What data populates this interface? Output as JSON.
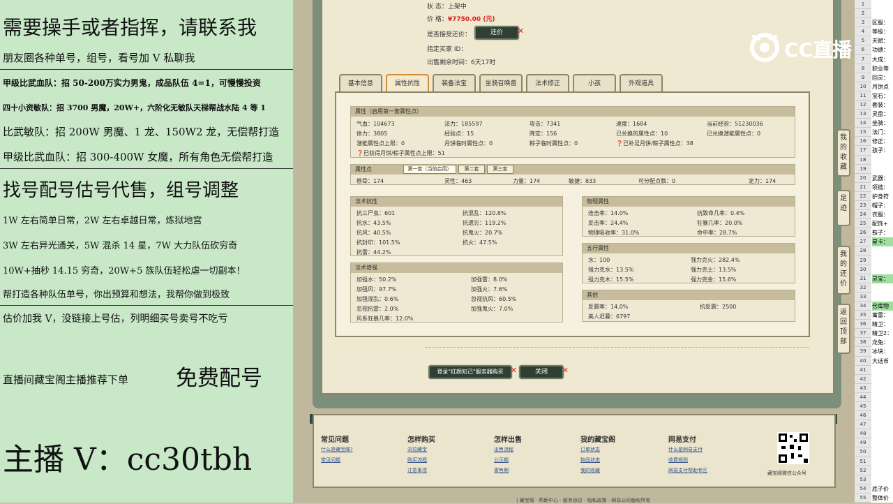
{
  "left": {
    "lines": [
      "需要操手或者指挥，请联系我",
      "朋友圈各种单号，组号，看号加 V 私聊我",
      "甲级比武血队：招 50-200万实力男鬼，成品队伍 4=1，可慢慢投资",
      "四十小资敏队：招 3700 男魔，20W+，六阶化无敏队天梯帮战水陆 4 等 1",
      "比武敏队：招 200W 男魔、1 龙、150W2 龙，无偿帮打造",
      "甲级比武血队：招 300-400W 女魔，所有角色无偿帮打造",
      "找号配号估号代售，组号调整",
      "1W 左右简单日常，2W 左右卓越日常，炼狱地宫",
      "3W 左右异光通关，5W 混杀 14 星，7W 大力队伍砍穷奇",
      "10W+抽秒 14.15 穷奇，20W+5 族队伍轻松虐一切副本！",
      "帮打造各种队伍单号，你出预算和想法，我帮你做到极致",
      "估价加我 V，没链接上号估，列明细买号卖号不吃亏",
      "直播间藏宝阁主播推荐下单",
      "免费配号",
      "主播 V：cc30tbh"
    ]
  },
  "game": {
    "info": {
      "status_label": "状        态：",
      "status_value": "上架中",
      "price_label": "价        格：",
      "price_value": "¥7750.00 (元)",
      "bargain_label": "是否接受还价：",
      "buyer_label": "指定买家 ID：",
      "time_label": "出售剩余时间：",
      "time_value": "6天17时"
    },
    "counter_offer_button": "还价",
    "tabs": [
      "基本信息",
      "属性抗性",
      "装备法宝",
      "坐骑召唤兽",
      "法术修正",
      "小孩",
      "外观道具"
    ],
    "attr_panel": {
      "title": "属性（启用第一套属性点）",
      "row1": [
        "气血：104673",
        "法力：185597",
        "攻击：7341",
        "速度：1684",
        "当前经验：51230036"
      ],
      "row2": [
        "体力：3805",
        "经验点：15",
        "降定：156",
        "已兑换的属性点：10",
        "已兑换潜能属性点：0"
      ],
      "row3": [
        "潜能属性点上限：0",
        "月饼临时属性点：0",
        "粽子临时属性点：0",
        "已补足月饼/粽子属性点：38"
      ],
      "row4": "已获得月饼/粽子属性点上限：51"
    },
    "points_panel": {
      "title": "属性点",
      "subtabs": [
        "第一套（当前启用）",
        "第二套",
        "第三套"
      ],
      "values": [
        "根骨：174",
        "灵性：463",
        "力量：174",
        "敏捷：833",
        "可分配点数：0",
        "定力：174"
      ]
    },
    "resist_panel": {
      "title": "法术抗性",
      "left": [
        "抗三尸虫：601",
        "抗水：43.5%",
        "抗风：40.5%",
        "抗封印：101.5%",
        "抗雷：44.2%"
      ],
      "right": [
        "抗混乱：120.8%",
        "抗遗忘：119.2%",
        "抗鬼火：20.7%",
        "抗火：47.5%"
      ]
    },
    "boost_panel": {
      "title": "法术增强",
      "left": [
        "加强水：50.2%",
        "加强风：97.7%",
        "加强混乱：0.6%",
        "忽视抗雷：2.0%",
        "风系狂暴几率：12.0%"
      ],
      "right": [
        "加强雷：8.0%",
        "加强火：7.6%",
        "忽视抗风：60.5%",
        "加强鬼火：7.0%"
      ]
    },
    "phys_panel": {
      "title": "物理属性",
      "left": [
        "连击率：14.0%",
        "反击率：24.4%",
        "物理吸收率：31.0%"
      ],
      "right": [
        "抗致命几率：0.4%",
        "狂暴几率：20.0%",
        "命中率：28.7%"
      ]
    },
    "wuxing_panel": {
      "title": "五行属性",
      "left": [
        "水：100",
        "强力克水：13.5%",
        "强力克木：15.5%"
      ],
      "right": [
        "强力克火：282.4%",
        "强力克土：13.5%",
        "强力克金：15.6%"
      ]
    },
    "other_panel": {
      "title": "其他",
      "left": [
        "反震率：14.0%",
        "美人迟暮：6797"
      ],
      "right": [
        "抗反震：2500"
      ]
    },
    "login_buy_button": "登录\"红颜知己\"服务器购买",
    "close_button": "关闭",
    "side_buttons": [
      "我的收藏",
      "足迹",
      "我的还价",
      "返回顶部"
    ],
    "footer": {
      "cols": [
        {
          "title": "常见问题",
          "links": [
            "什么是藏宝阁?",
            "常见问题"
          ]
        },
        {
          "title": "怎样购买",
          "links": [
            "浏览藏宝",
            "购买流程",
            "注意事项"
          ]
        },
        {
          "title": "怎样出售",
          "links": [
            "出售流程",
            "公示期",
            "寄售期"
          ]
        },
        {
          "title": "我的藏宝阁",
          "links": [
            "订单状态",
            "物品状态",
            "我的收藏"
          ]
        },
        {
          "title": "网易支付",
          "links": [
            "什么是网易支付",
            "收费规则",
            "网易支付帮助专区"
          ]
        }
      ],
      "qr_caption": "藏宝阁微信公众号"
    },
    "bottom_text": "| 藏宝阁 · 帮助中心 · 服务协议 · 隐私政策 · 网易公司版权所有"
  },
  "logo": {
    "text": "CC直播"
  },
  "sheet": {
    "rows": [
      {
        "n": "1",
        "t": ""
      },
      {
        "n": "2",
        "t": ""
      },
      {
        "n": "3",
        "t": "区服："
      },
      {
        "n": "4",
        "t": "等级："
      },
      {
        "n": "5",
        "t": "天赋："
      },
      {
        "n": "6",
        "t": "功绩："
      },
      {
        "n": "7",
        "t": "大成："
      },
      {
        "n": "8",
        "t": "职业等"
      },
      {
        "n": "9",
        "t": "回灵："
      },
      {
        "n": "10",
        "t": "月饼点"
      },
      {
        "n": "11",
        "t": "宝石："
      },
      {
        "n": "12",
        "t": "套装："
      },
      {
        "n": "13",
        "t": "灵盘："
      },
      {
        "n": "14",
        "t": "坐骑："
      },
      {
        "n": "15",
        "t": "法门："
      },
      {
        "n": "16",
        "t": "修正："
      },
      {
        "n": "17",
        "t": "孩子："
      },
      {
        "n": "18",
        "t": ""
      },
      {
        "n": "19",
        "t": ""
      },
      {
        "n": "20",
        "t": "武器："
      },
      {
        "n": "21",
        "t": "项链："
      },
      {
        "n": "22",
        "t": "护身符"
      },
      {
        "n": "23",
        "t": "帽子："
      },
      {
        "n": "24",
        "t": "衣服："
      },
      {
        "n": "25",
        "t": "配饰+"
      },
      {
        "n": "26",
        "t": "鞋子："
      },
      {
        "n": "27",
        "t": "星卡："
      },
      {
        "n": "28",
        "t": ""
      },
      {
        "n": "29",
        "t": ""
      },
      {
        "n": "30",
        "t": ""
      },
      {
        "n": "31",
        "t": "灵宝："
      },
      {
        "n": "32",
        "t": ""
      },
      {
        "n": "33",
        "t": ""
      },
      {
        "n": "34",
        "t": "仓库物"
      },
      {
        "n": "35",
        "t": "寓雷："
      },
      {
        "n": "36",
        "t": "精卫："
      },
      {
        "n": "37",
        "t": "精卫2："
      },
      {
        "n": "38",
        "t": "龙兔："
      },
      {
        "n": "39",
        "t": "冰块："
      },
      {
        "n": "40",
        "t": "大话币"
      },
      {
        "n": "41",
        "t": ""
      },
      {
        "n": "42",
        "t": ""
      },
      {
        "n": "43",
        "t": ""
      },
      {
        "n": "44",
        "t": ""
      },
      {
        "n": "45",
        "t": ""
      },
      {
        "n": "46",
        "t": ""
      },
      {
        "n": "47",
        "t": ""
      },
      {
        "n": "48",
        "t": ""
      },
      {
        "n": "49",
        "t": ""
      },
      {
        "n": "50",
        "t": ""
      },
      {
        "n": "51",
        "t": ""
      },
      {
        "n": "52",
        "t": ""
      },
      {
        "n": "53",
        "t": ""
      },
      {
        "n": "54",
        "t": "底子价"
      },
      {
        "n": "55",
        "t": "整体价"
      }
    ],
    "highlight_rows": [
      "27",
      "31",
      "34"
    ],
    "highlight_color": "#9fe09f"
  }
}
